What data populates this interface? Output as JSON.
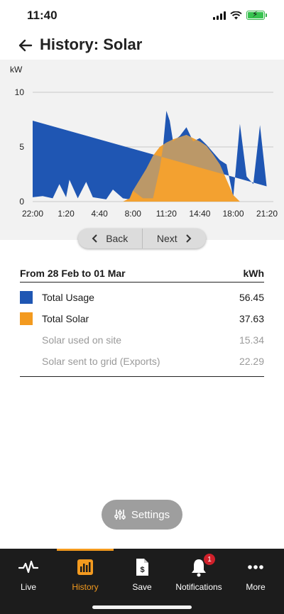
{
  "status": {
    "time": "11:40"
  },
  "header": {
    "title": "History: Solar"
  },
  "colors": {
    "usage": "#1f56b3",
    "solar": "#f39a1f",
    "solar_overlap": "#9a9a9a",
    "accent": "#f39a1f",
    "nav_bg": "#1c1c1c"
  },
  "chart_data": {
    "type": "area",
    "ylabel": "kW",
    "ylim": [
      0,
      10
    ],
    "y_ticks": [
      "0",
      "5",
      "10"
    ],
    "x_ticks": [
      "22:00",
      "1:20",
      "4:40",
      "8:00",
      "11:20",
      "14:40",
      "18:00",
      "21:20"
    ],
    "grid": true,
    "series": [
      {
        "name": "Total Usage",
        "color": "#1f56b3",
        "x": [
          "22:00",
          "23:00",
          "0:00",
          "0:40",
          "1:20",
          "1:40",
          "2:30",
          "3:20",
          "4:00",
          "4:40",
          "5:20",
          "6:00",
          "7:00",
          "7:40",
          "8:00",
          "9:00",
          "10:00",
          "10:40",
          "11:00",
          "11:20",
          "11:40",
          "12:00",
          "12:40",
          "13:20",
          "14:00",
          "14:40",
          "15:20",
          "16:00",
          "16:40",
          "17:20",
          "18:00",
          "18:40",
          "19:20",
          "20:00",
          "20:40",
          "21:20",
          "22:00"
        ],
        "values": [
          0.4,
          0.5,
          0.3,
          1.6,
          0.4,
          2.0,
          0.3,
          1.8,
          0.4,
          0.3,
          0.2,
          1.1,
          0.3,
          0.2,
          1.0,
          0.3,
          0.3,
          3.0,
          5.0,
          8.3,
          7.4,
          5.5,
          6.0,
          6.8,
          5.5,
          5.8,
          5.2,
          4.5,
          3.8,
          3.4,
          0.4,
          7.1,
          2.3,
          1.6,
          7.0,
          1.4,
          7.4
        ]
      },
      {
        "name": "Total Solar",
        "color": "#f39a1f",
        "x": [
          "22:00",
          "7:00",
          "7:40",
          "8:00",
          "8:40",
          "9:20",
          "10:00",
          "10:40",
          "11:20",
          "12:00",
          "12:40",
          "13:20",
          "14:00",
          "14:40",
          "15:20",
          "16:00",
          "16:40",
          "17:20",
          "18:00",
          "18:40",
          "22:00"
        ],
        "values": [
          0,
          0,
          0.3,
          1.0,
          2.0,
          3.0,
          4.2,
          5.0,
          5.4,
          5.7,
          5.9,
          6.1,
          5.8,
          5.5,
          5.1,
          4.3,
          3.4,
          2.0,
          0.6,
          0,
          0
        ]
      }
    ]
  },
  "pager": {
    "back_label": "Back",
    "next_label": "Next"
  },
  "summary": {
    "period": "From 28 Feb to 01 Mar",
    "unit": "kWh",
    "rows": [
      {
        "label": "Total Usage",
        "value": "56.45"
      },
      {
        "label": "Total Solar",
        "value": "37.63"
      },
      {
        "label": "Solar used on site",
        "value": "15.34"
      },
      {
        "label": "Solar sent to grid (Exports)",
        "value": "22.29"
      }
    ]
  },
  "settings": {
    "label": "Settings"
  },
  "nav": {
    "items": [
      {
        "label": "Live",
        "icon": "pulse-icon"
      },
      {
        "label": "History",
        "icon": "bar-chart-icon"
      },
      {
        "label": "Save",
        "icon": "dollar-document-icon"
      },
      {
        "label": "Notifications",
        "icon": "bell-icon",
        "badge": "1"
      },
      {
        "label": "More",
        "icon": "more-dots-icon"
      }
    ]
  }
}
